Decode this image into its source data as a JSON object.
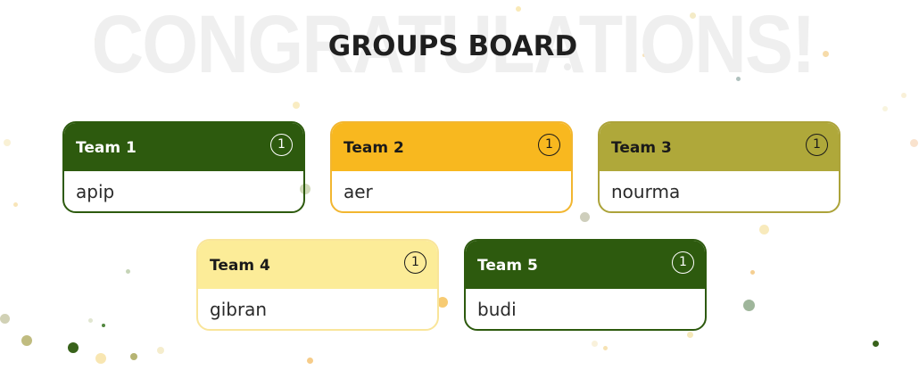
{
  "background_text": "CONGRATULATIONS!",
  "title": "GROUPS BOARD",
  "teams": [
    {
      "name": "Team 1",
      "count": "1",
      "member": "apip",
      "color": "#2d5a0e"
    },
    {
      "name": "Team 2",
      "count": "1",
      "member": "aer",
      "color": "#f8b81f"
    },
    {
      "name": "Team 3",
      "count": "1",
      "member": "nourma",
      "color": "#afa83a"
    },
    {
      "name": "Team 4",
      "count": "1",
      "member": "gibran",
      "color": "#fcec98"
    },
    {
      "name": "Team 5",
      "count": "1",
      "member": "budi",
      "color": "#2d5a0e"
    }
  ]
}
